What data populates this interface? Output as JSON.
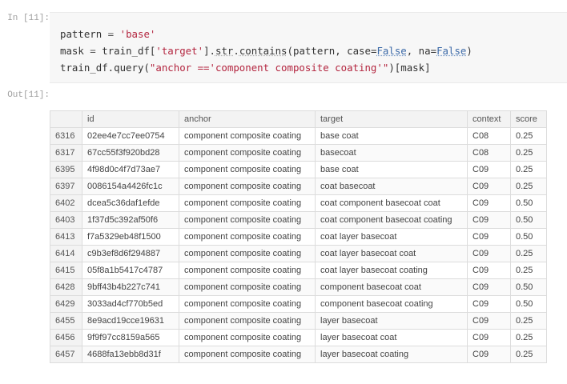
{
  "cell": {
    "in_prompt": "In [11]:",
    "out_prompt": "Out[11]:",
    "code": {
      "line1": {
        "var": "pattern",
        "op": " = ",
        "str": "'base'"
      },
      "line2": {
        "var": "mask",
        "op": " = ",
        "obj": "train_df[",
        "key": "'target'",
        "mid": "].",
        "fn1": "str",
        "dot": ".",
        "fn2": "contains",
        "args_start": "(pattern, case=",
        "kw1": "False",
        "sep": ", na=",
        "kw2": "False",
        "close": ")"
      },
      "line3": {
        "prefix": "train_df.query(",
        "str": "\"anchor =='component composite coating'\"",
        "suffix": ")[mask]"
      }
    }
  },
  "table": {
    "columns": [
      "",
      "id",
      "anchor",
      "target",
      "context",
      "score"
    ],
    "rows": [
      {
        "index": "6316",
        "id": "02ee4e7cc7ee0754",
        "anchor": "component composite coating",
        "target": "base coat",
        "context": "C08",
        "score": "0.25"
      },
      {
        "index": "6317",
        "id": "67cc55f3f920bd28",
        "anchor": "component composite coating",
        "target": "basecoat",
        "context": "C08",
        "score": "0.25"
      },
      {
        "index": "6395",
        "id": "4f98d0c4f7d73ae7",
        "anchor": "component composite coating",
        "target": "base coat",
        "context": "C09",
        "score": "0.25"
      },
      {
        "index": "6397",
        "id": "0086154a4426fc1c",
        "anchor": "component composite coating",
        "target": "coat basecoat",
        "context": "C09",
        "score": "0.25"
      },
      {
        "index": "6402",
        "id": "dcea5c36daf1efde",
        "anchor": "component composite coating",
        "target": "coat component basecoat coat",
        "context": "C09",
        "score": "0.50"
      },
      {
        "index": "6403",
        "id": "1f37d5c392af50f6",
        "anchor": "component composite coating",
        "target": "coat component basecoat coating",
        "context": "C09",
        "score": "0.50"
      },
      {
        "index": "6413",
        "id": "f7a5329eb48f1500",
        "anchor": "component composite coating",
        "target": "coat layer basecoat",
        "context": "C09",
        "score": "0.50"
      },
      {
        "index": "6414",
        "id": "c9b3ef8d6f294887",
        "anchor": "component composite coating",
        "target": "coat layer basecoat coat",
        "context": "C09",
        "score": "0.25"
      },
      {
        "index": "6415",
        "id": "05f8a1b5417c4787",
        "anchor": "component composite coating",
        "target": "coat layer basecoat coating",
        "context": "C09",
        "score": "0.25"
      },
      {
        "index": "6428",
        "id": "9bff43b4b227c741",
        "anchor": "component composite coating",
        "target": "component basecoat coat",
        "context": "C09",
        "score": "0.50"
      },
      {
        "index": "6429",
        "id": "3033ad4cf770b5ed",
        "anchor": "component composite coating",
        "target": "component basecoat coating",
        "context": "C09",
        "score": "0.50"
      },
      {
        "index": "6455",
        "id": "8e9acd19cce19631",
        "anchor": "component composite coating",
        "target": "layer basecoat",
        "context": "C09",
        "score": "0.25"
      },
      {
        "index": "6456",
        "id": "9f9f97cc8159a565",
        "anchor": "component composite coating",
        "target": "layer basecoat coat",
        "context": "C09",
        "score": "0.25"
      },
      {
        "index": "6457",
        "id": "4688fa13ebb8d31f",
        "anchor": "component composite coating",
        "target": "layer basecoat coating",
        "context": "C09",
        "score": "0.25"
      }
    ]
  }
}
